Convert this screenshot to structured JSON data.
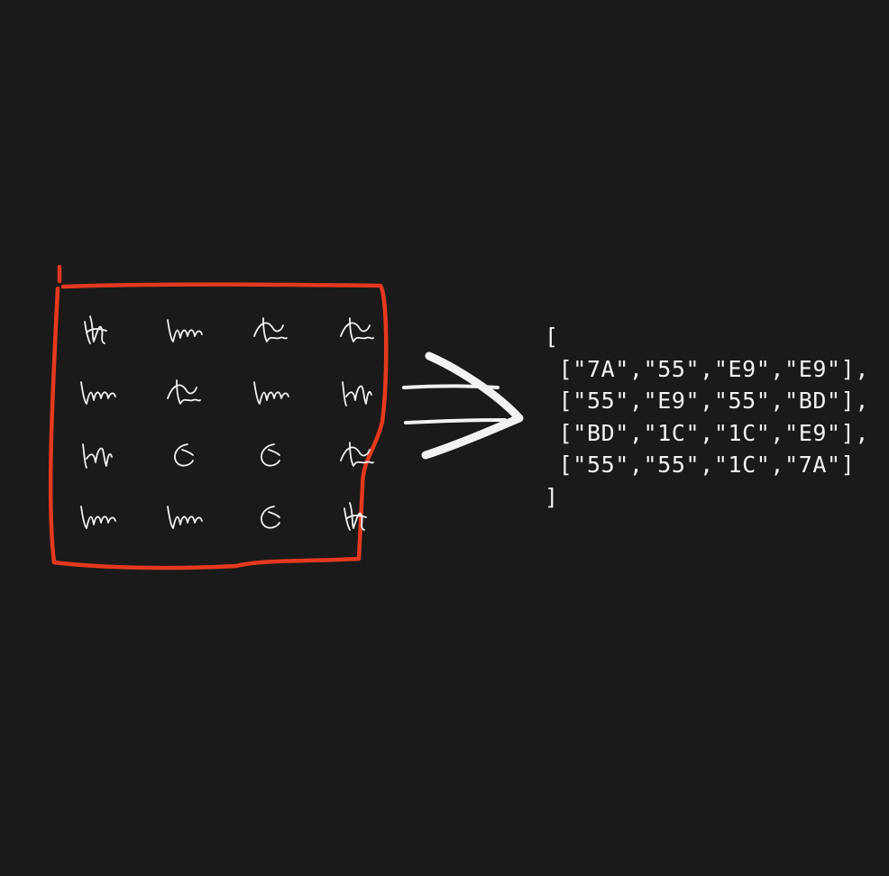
{
  "colors": {
    "background": "#1a1a1a",
    "frame": "#e5391f",
    "ink": "#f2f2f2"
  },
  "grid": {
    "rows": 4,
    "cols": 4,
    "cells": [
      [
        "7A",
        "55",
        "E9",
        "E9"
      ],
      [
        "55",
        "E9",
        "55",
        "BD"
      ],
      [
        "BD",
        "1C",
        "1C",
        "E9"
      ],
      [
        "55",
        "55",
        "1C",
        "7A"
      ]
    ]
  },
  "code_lines": [
    "[",
    " [\"7A\",\"55\",\"E9\",\"E9\"],",
    " [\"55\",\"E9\",\"55\",\"BD\"],",
    " [\"BD\",\"1C\",\"1C\",\"E9\"],",
    " [\"55\",\"55\",\"1C\",\"7A\"]",
    "]"
  ],
  "icons": {
    "arrow": "double-arrow-right-icon",
    "scribble": "handwritten-scribble-icon"
  }
}
